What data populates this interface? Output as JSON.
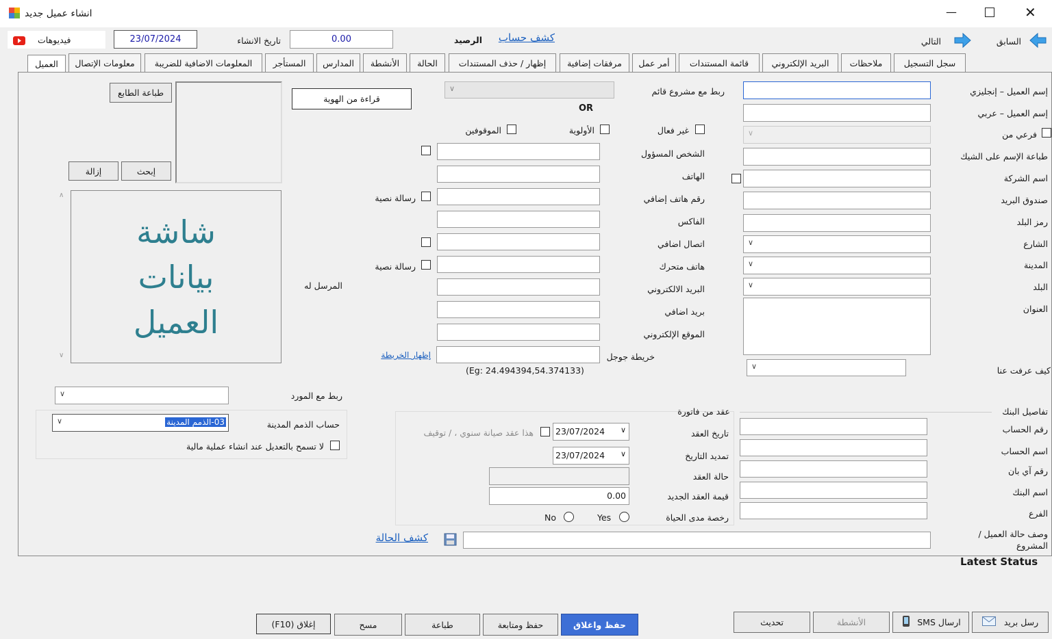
{
  "window": {
    "title": "انشاء عميل جديد"
  },
  "topbar": {
    "videos_label": "فيديوهات",
    "date_value": "23/07/2024",
    "creation_date_label": "تاريخ الانشاء",
    "balance_value": "0.00",
    "balance_label": "الرصيد",
    "account_statement_link": "كشف حساب",
    "next_label": "التالي",
    "previous_label": "السابق"
  },
  "tabs": [
    "العميل",
    "معلومات الإتصال",
    "المعلومات الاضافية للضريبة",
    "المستأجر",
    "المدارس",
    "الأنشطة",
    "الحالة",
    "إظهار / حذف المستندات",
    "مرفقات إضافية",
    "أمر عمل",
    "قائمة المستندات",
    "البريد الإلكتروني",
    "ملاحظات",
    "سجل التسجيل"
  ],
  "right_form": {
    "name_en": "إسم العميل – إنجليزي",
    "name_ar": "إسم العميل – عربي",
    "branch_of": "فرعي من",
    "print_name_cheque": "طباعة الإسم على الشيك",
    "company_name": "اسم الشركة",
    "po_box": "صندوق البريد",
    "country_code": "رمز البلد",
    "street": "الشارع",
    "city": "المدينة",
    "country": "البلد",
    "address": "العنوان",
    "how_know_us": "كيف عرفت عنا"
  },
  "middle_form": {
    "link_project": "ربط مع مشروع قائم",
    "or_label": "OR",
    "inactive": "غير فعال",
    "priority": "الأولوية",
    "suspended": "الموقوفين",
    "responsible": "الشخص المسؤول",
    "phone": "الهاتف",
    "extra_phone": "رقم هاتف إضافي",
    "fax": "الفاكس",
    "extra_contact": "اتصال اضافي",
    "mobile": "هاتف متحرك",
    "email": "البريد الالكتروني",
    "extra_email": "بريد اضافي",
    "website": "الموقع الإلكتروني",
    "google_map": "خريطة جوجل",
    "sms1": "رسالة نصية",
    "sms2": "رسالة نصية",
    "sent_to": "المرسل له",
    "show_map_link": "إظهار الخريطة",
    "coords_hint": "(Eg: 24.494394,54.374133)",
    "read_id_button": "قراءة من الهوية"
  },
  "left_panel": {
    "print_stamp_button": "طباعة الطابع",
    "search_button": "إبحث",
    "remove_button": "إزالة",
    "placeholder_line1": "شاشة",
    "placeholder_line2": "بيانات",
    "placeholder_line3": "العميل",
    "link_supplier": "ربط مع المورد",
    "receivables_account": "حساب الذمم المدينة",
    "receivables_value": "03-الذمم المدينة",
    "no_edit_checkbox": "لا تسمح بالتعديل عند انشاء عملية مالية"
  },
  "contract": {
    "from_invoice": "عقد من فاتورة",
    "contract_date": "تاريخ العقد",
    "contract_date_value": "23/07/2024",
    "annual_maintenance": "هذا عقد صيانة سنوي ، / توقيف",
    "extend_date": "تمديد التاريخ",
    "extend_date_value": "23/07/2024",
    "contract_status": "حالة العقد",
    "new_contract_value": "قيمة العقد الجديد",
    "new_contract_amount": "0.00",
    "lifetime_license": "رخصة مدى الحياة",
    "yes": "Yes",
    "no": "No"
  },
  "bank": {
    "title": "تفاصيل البنك",
    "account_no": "رقم الحساب",
    "account_name": "اسم الحساب",
    "iban": "رقم آي بان",
    "bank_name": "اسم البنك",
    "branch": "الفرع"
  },
  "bottom": {
    "description_label": "وصف حالة العميل / المشروع",
    "status_link": "كشف الحالة",
    "latest_status": "Latest Status"
  },
  "footer": {
    "close_f10": "إغلاق (F10)",
    "clear": "مسح",
    "print": "طباعة",
    "save_follow": "حفظ ومتابعة",
    "save_close": "حفظ واغلاق",
    "update": "تحديث",
    "activities": "الأنشطة",
    "send_sms": "ارسال SMS",
    "send_mail": "رسل بريد"
  },
  "colors": {
    "accent": "#1a5fbf",
    "placeholder_text": "#2e7f8f",
    "primary_button": "#3d6fd6"
  }
}
